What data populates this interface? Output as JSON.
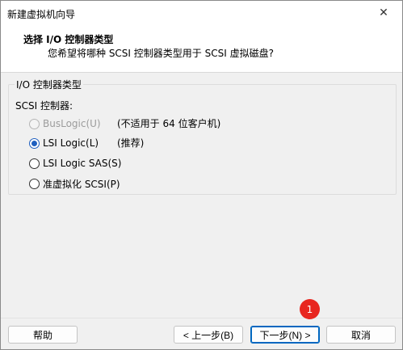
{
  "window": {
    "title": "新建虚拟机向导",
    "close_glyph": "✕"
  },
  "header": {
    "title": "选择 I/O 控制器类型",
    "subtitle": "您希望将哪种 SCSI 控制器类型用于 SCSI 虚拟磁盘?"
  },
  "group": {
    "legend": "I/O 控制器类型",
    "scsi_label": "SCSI 控制器:",
    "options": [
      {
        "label": "BusLogic(U)",
        "note": "(不适用于 64 位客户机)",
        "checked": false,
        "disabled": true
      },
      {
        "label": "LSI Logic(L)",
        "note": "(推荐)",
        "checked": true,
        "disabled": false
      },
      {
        "label": "LSI Logic SAS(S)",
        "note": "",
        "checked": false,
        "disabled": false
      },
      {
        "label": "准虚拟化 SCSI(P)",
        "note": "",
        "checked": false,
        "disabled": false
      }
    ]
  },
  "footer": {
    "help": "帮助",
    "back": "< 上一步(B)",
    "next": "下一步(N) >",
    "cancel": "取消"
  },
  "annotation": {
    "badge_number": "1",
    "badge_color": "#e8261f"
  },
  "colors": {
    "accent": "#0067c0",
    "radio_checked": "#1f5fbf"
  }
}
